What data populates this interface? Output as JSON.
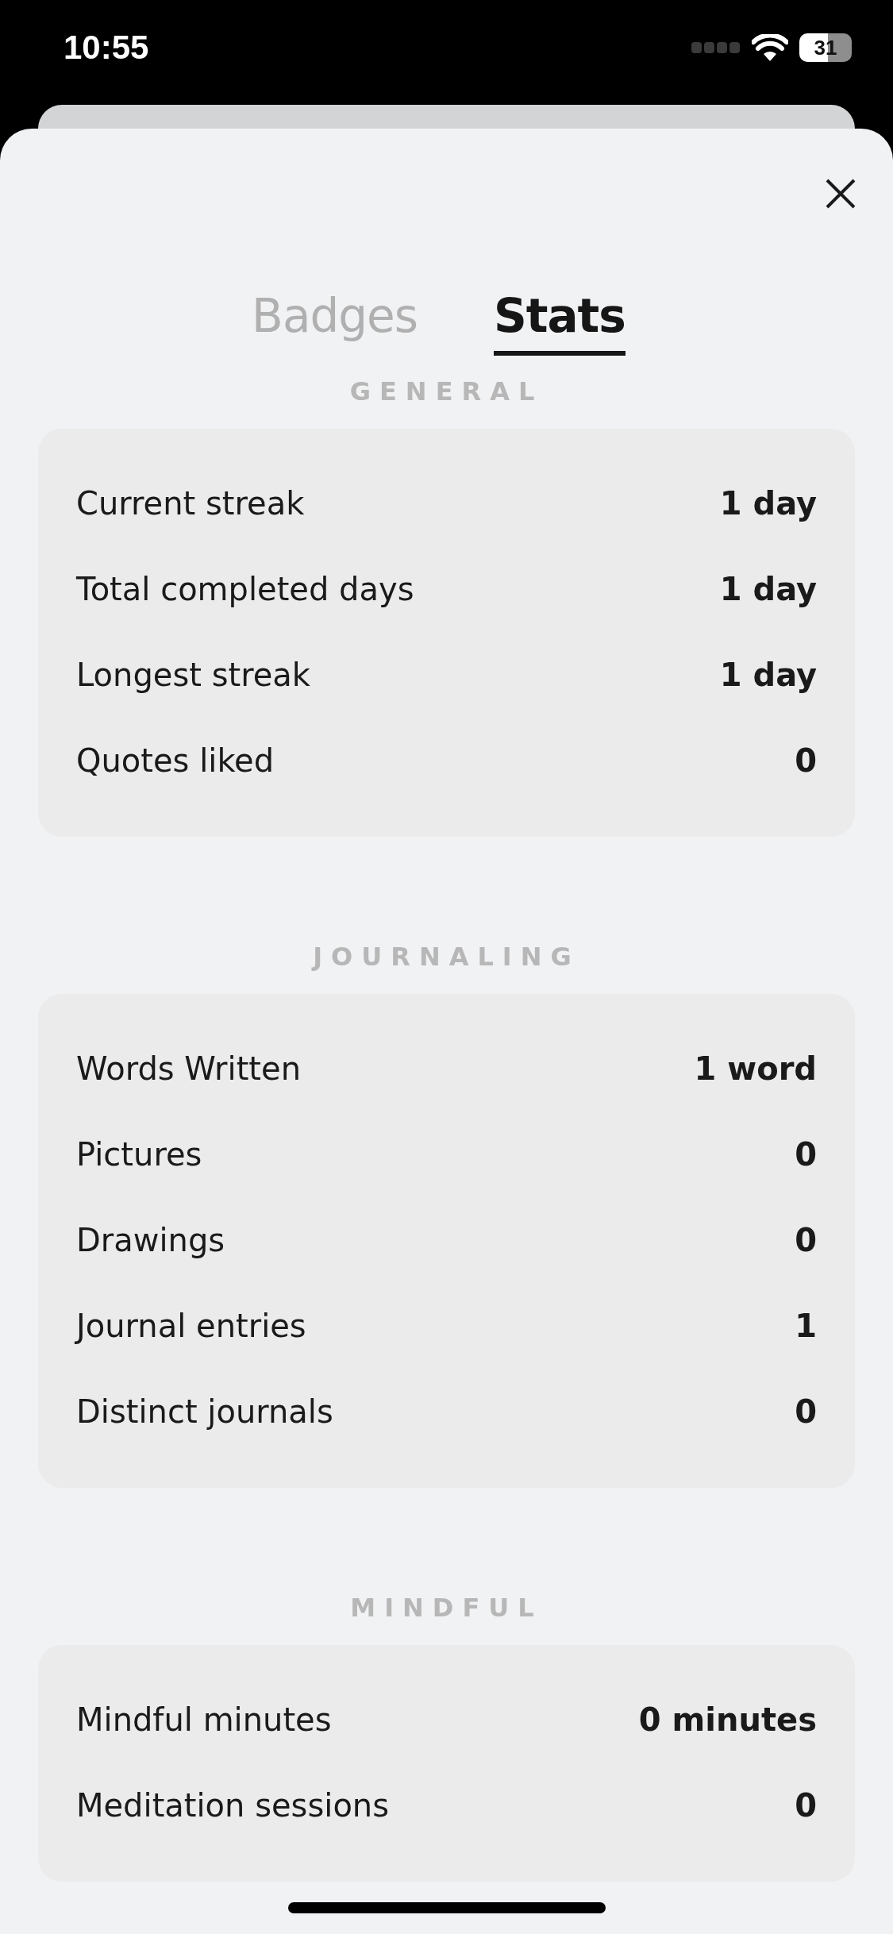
{
  "status_bar": {
    "time": "10:55",
    "battery": "31"
  },
  "tabs": [
    {
      "label": "Badges",
      "selected": false
    },
    {
      "label": "Stats",
      "selected": true
    }
  ],
  "sections": [
    {
      "title": "GENERAL",
      "rows": [
        {
          "label": "Current streak",
          "value": "1 day"
        },
        {
          "label": "Total completed days",
          "value": "1 day"
        },
        {
          "label": "Longest streak",
          "value": "1 day"
        },
        {
          "label": "Quotes liked",
          "value": "0"
        }
      ]
    },
    {
      "title": "JOURNALING",
      "rows": [
        {
          "label": "Words Written",
          "value": "1 word"
        },
        {
          "label": "Pictures",
          "value": "0"
        },
        {
          "label": "Drawings",
          "value": "0"
        },
        {
          "label": "Journal entries",
          "value": "1"
        },
        {
          "label": "Distinct journals",
          "value": "0"
        }
      ]
    },
    {
      "title": "MINDFUL",
      "rows": [
        {
          "label": "Mindful minutes",
          "value": "0 minutes"
        },
        {
          "label": "Meditation sessions",
          "value": "0"
        }
      ]
    }
  ]
}
